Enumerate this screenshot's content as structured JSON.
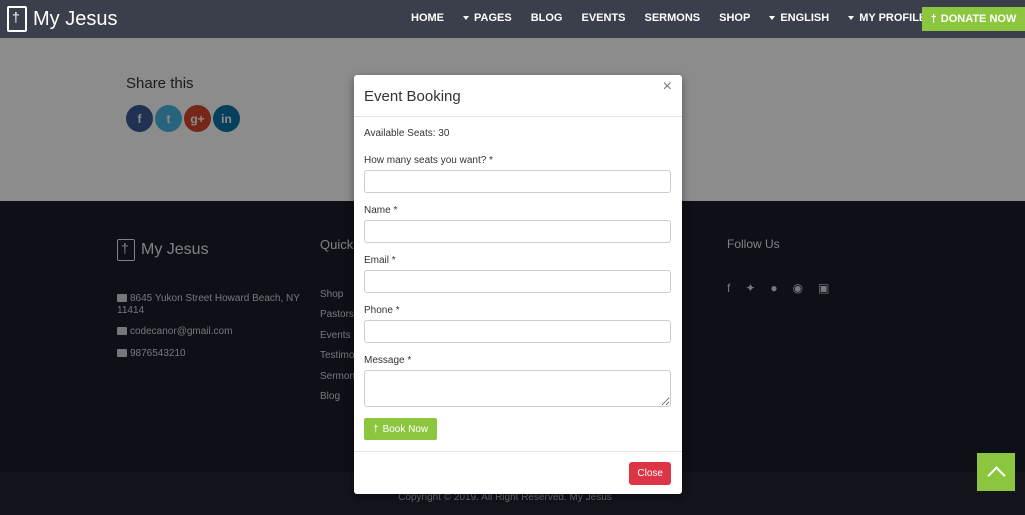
{
  "nav": {
    "brand": "My Jesus",
    "items": [
      {
        "label": "HOME",
        "caret": false
      },
      {
        "label": "PAGES",
        "caret": true
      },
      {
        "label": "BLOG",
        "caret": false
      },
      {
        "label": "EVENTS",
        "caret": false
      },
      {
        "label": "SERMONS",
        "caret": false
      },
      {
        "label": "SHOP",
        "caret": false
      },
      {
        "label": "ENGLISH",
        "caret": true
      },
      {
        "label": "MY PROFILE",
        "caret": true
      }
    ],
    "donate": "DONATE NOW"
  },
  "share": {
    "title": "Share this",
    "icons": [
      {
        "name": "facebook-icon",
        "glyph": "f",
        "color": "#3b5998"
      },
      {
        "name": "twitter-icon",
        "glyph": "t",
        "color": "#4cb6e6"
      },
      {
        "name": "google-plus-icon",
        "glyph": "g+",
        "color": "#d6492f"
      },
      {
        "name": "linkedin-icon",
        "glyph": "in",
        "color": "#0e76a8"
      }
    ]
  },
  "footer": {
    "brand": "My Jesus",
    "address": "8645 Yukon Street Howard Beach, NY 11414",
    "email": "codecanor@gmail.com",
    "phone": "9876543210",
    "quick_title": "Quick",
    "links": [
      "Shop",
      "Pastors",
      "Events",
      "Testimo",
      "Sermon",
      "Blog"
    ],
    "follow_title": "Follow Us",
    "copyright": "Copyright © 2019. All Right Reserved. My Jesus"
  },
  "modal": {
    "title": "Event Booking",
    "available_seats": "Available Seats: 30",
    "fields": [
      {
        "label": "How many seats you want? *",
        "value": ""
      },
      {
        "label": "Name *",
        "value": ""
      },
      {
        "label": "Email *",
        "value": ""
      },
      {
        "label": "Phone *",
        "value": ""
      },
      {
        "label": "Message *",
        "value": ""
      }
    ],
    "book_now": "Book Now",
    "close": "Close"
  },
  "colors": {
    "accent": "#8cc63f",
    "danger": "#dc3545",
    "navbar": "#3b3e4b",
    "footer": "#1b1e2a"
  }
}
